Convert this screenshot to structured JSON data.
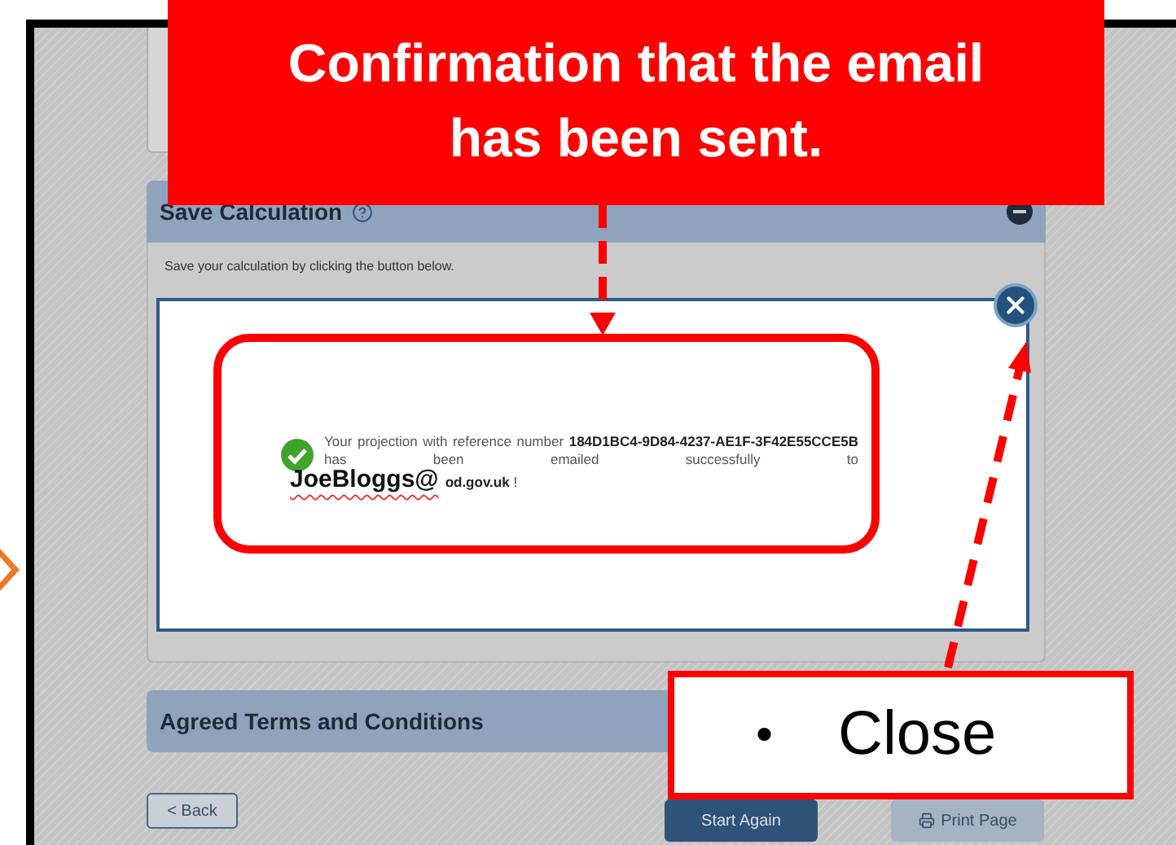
{
  "callout_top": {
    "text": "Confirmation that the email has been sent."
  },
  "callout_close": {
    "bullet": "•",
    "text": "Close"
  },
  "sections": [
    {
      "title": "Save Calculation",
      "help": true,
      "expanded": true,
      "description": "Save your calculation by clicking the button below."
    },
    {
      "title": "Agreed Terms and Conditions",
      "help": false
    }
  ],
  "dialog": {
    "message": "Your projection with reference number **184D1BC4-9D84-4237-AE1F-3F42E55CCE5B** has been emailed successfully to",
    "email_user": "JoeBloggs@",
    "email_rest": "**od.gov.uk** !"
  },
  "buttons": [
    {
      "label": "< Back",
      "kind": "back"
    },
    {
      "label": "Start Again",
      "kind": "primary"
    },
    {
      "label": "Print Page",
      "kind": "print"
    }
  ]
}
